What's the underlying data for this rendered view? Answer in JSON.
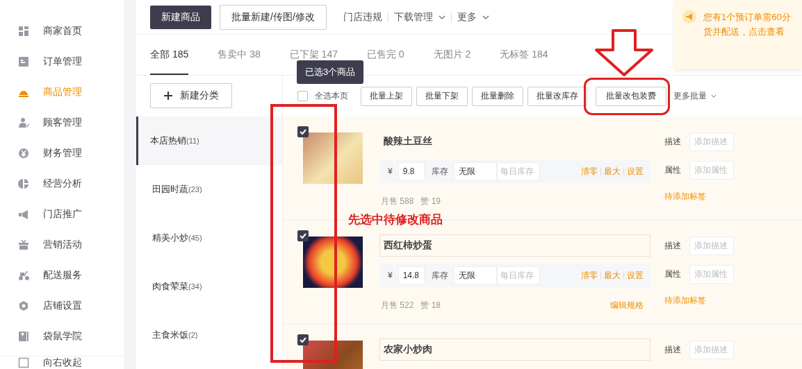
{
  "sidebar": {
    "items": [
      {
        "label": "商家首页",
        "selected": false
      },
      {
        "label": "订单管理",
        "selected": false
      },
      {
        "label": "商品管理",
        "selected": true
      },
      {
        "label": "顾客管理",
        "selected": false
      },
      {
        "label": "财务管理",
        "selected": false
      },
      {
        "label": "经营分析",
        "selected": false
      },
      {
        "label": "门店推广",
        "selected": false
      },
      {
        "label": "营销活动",
        "selected": false
      },
      {
        "label": "配送服务",
        "selected": false
      },
      {
        "label": "店铺设置",
        "selected": false
      },
      {
        "label": "袋鼠学院",
        "selected": false
      }
    ],
    "collapse": "向右收起"
  },
  "toolbar": {
    "primary": "新建商品",
    "secondary": "批量新建/传图/修改",
    "links": [
      {
        "label": "门店违规",
        "dropdown": false
      },
      {
        "label": "下载管理",
        "dropdown": true
      },
      {
        "label": "更多",
        "dropdown": true
      }
    ]
  },
  "notification": {
    "lines": [
      "您有1个预订单需60分",
      "货并配送，点击查看"
    ]
  },
  "tabs": [
    {
      "label": "全部 185",
      "selected": true
    },
    {
      "label": "售卖中 38",
      "selected": false
    },
    {
      "label": "已下架 147",
      "selected": false
    },
    {
      "label": "已售完 0",
      "selected": false
    },
    {
      "label": "无图片 2",
      "selected": false
    },
    {
      "label": "无标签 184",
      "selected": false
    }
  ],
  "new_category": "新建分类",
  "categories": [
    {
      "name": "本店热销",
      "count": "(11)",
      "selected": true
    },
    {
      "name": "田园时蔬",
      "count": "(23)",
      "selected": false
    },
    {
      "name": "精美小炒",
      "count": "(45)",
      "selected": false
    },
    {
      "name": "肉食荤菜",
      "count": "(34)",
      "selected": false
    },
    {
      "name": "主食米饭",
      "count": "(2)",
      "selected": false
    }
  ],
  "bulk": {
    "tooltip": "已选3个商品",
    "select_all": {
      "label": "全选本页",
      "checked": false
    },
    "buttons": [
      "批量上架",
      "批量下架",
      "批量删除",
      "批量改库存",
      "批量改包装费"
    ],
    "more": "更多批量"
  },
  "products": [
    {
      "name": "酸辣土豆丝",
      "checked": true,
      "currency": "¥",
      "price": "9.8",
      "stock_label": "库存",
      "stock": "无限",
      "daily_placeholder": "每日库存",
      "actions": [
        "清零",
        "最大",
        "设置"
      ],
      "sales": "月售  588",
      "likes": "赞  19",
      "desc_label": "描述",
      "desc_placeholder": "添加描述",
      "attr_label": "属性",
      "attr_placeholder": "添加属性",
      "tag_link": "待添加标签"
    },
    {
      "name": "西红柿炒蛋",
      "checked": true,
      "currency": "¥",
      "price": "14.8",
      "stock_label": "库存",
      "stock": "无限",
      "daily_placeholder": "每日库存",
      "actions": [
        "清零",
        "最大",
        "设置"
      ],
      "sales": "月售  522",
      "likes": "赞  18",
      "spec_link": "编辑规格",
      "desc_label": "描述",
      "desc_placeholder": "添加描述",
      "attr_label": "属性",
      "attr_placeholder": "添加属性",
      "tag_link": "待添加标签"
    },
    {
      "name": "农家小炒肉",
      "checked": true,
      "desc_label": "描述",
      "desc_placeholder": "添加描述"
    }
  ],
  "annotations": {
    "note": "先选中待修改商品"
  }
}
